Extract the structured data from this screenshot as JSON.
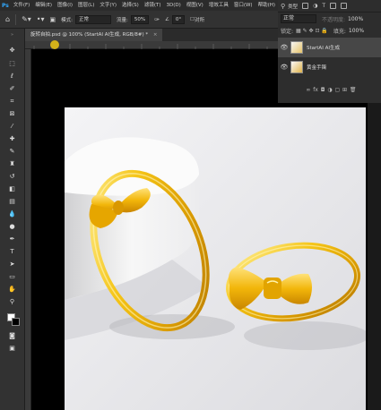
{
  "menubar": {
    "logo": "Ps",
    "items": [
      "文件(F)",
      "编辑(E)",
      "图像(I)",
      "图层(L)",
      "文字(Y)",
      "选择(S)",
      "滤镜(T)",
      "3D(D)",
      "视图(V)",
      "增效工具",
      "窗口(W)",
      "帮助(H)"
    ]
  },
  "options": {
    "mode_label": "模式:",
    "mode_value": "正常",
    "opacity_label": "不透明度:",
    "opacity_value": "100%",
    "flow_label": "流量:",
    "flow_value": "50%",
    "angle_value": "0°",
    "sample_label": "对所"
  },
  "tab": {
    "title": "旋转自拍.psd @ 100% (StartAI AI生成, RGB/8#) *",
    "close": "×"
  },
  "panel": {
    "search_kind": "类型",
    "blend_mode": "正常",
    "opacity_label": "不透明度:",
    "opacity_value": "100%",
    "lock_label": "锁定:",
    "fill_label": "填充:",
    "fill_value": "100%",
    "layers": [
      {
        "name": "StartAI AI生成"
      },
      {
        "name": "黄金手镯"
      }
    ],
    "footer": [
      "∞",
      "fx",
      "◘",
      "◑",
      "▢",
      "⊞",
      "🗑"
    ]
  },
  "icons": {
    "eye": "👁",
    "tools": [
      "move-tool-icon",
      "artboard-icon",
      "marquee-icon",
      "lasso-icon",
      "quick-select-icon",
      "crop-icon",
      "frame-icon",
      "eyedropper-icon",
      "healing-icon",
      "brush-icon",
      "clone-stamp-icon",
      "history-brush-icon",
      "eraser-icon",
      "gradient-icon",
      "blur-icon",
      "dodge-icon",
      "pen-icon",
      "type-icon",
      "path-select-icon",
      "rectangle-icon",
      "hand-icon",
      "zoom-icon"
    ]
  },
  "colors": {
    "accent": "#1473e6",
    "gold": "#e8b00c"
  }
}
